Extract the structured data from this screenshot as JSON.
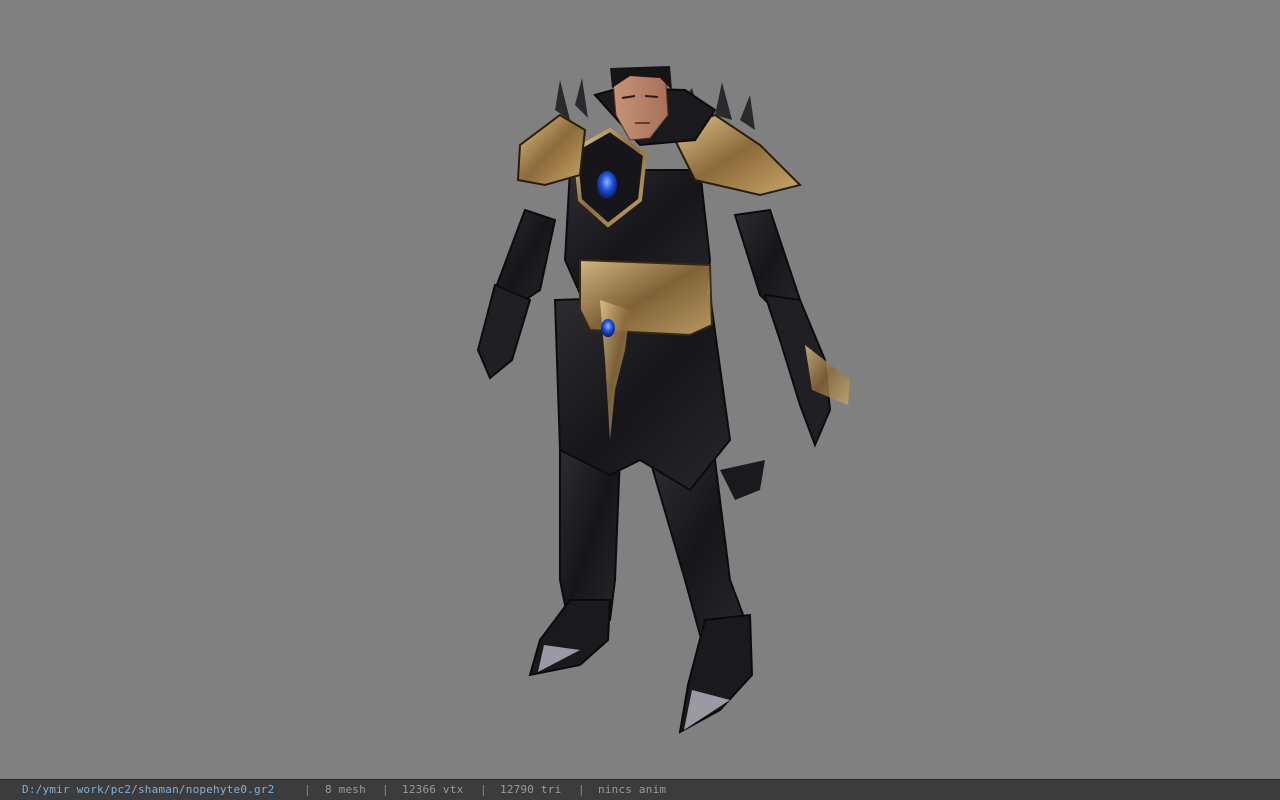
{
  "viewer": {
    "background_color": "#808080",
    "model_icon": "armored-character-model"
  },
  "status": {
    "file_path": "D:/ymir work/pc2/shaman/nopehyte0.gr2",
    "mesh_count": "8 mesh",
    "vertex_count": "12366 vtx",
    "triangle_count": "12790 tri",
    "anim_status": "nincs anim",
    "separator": "|"
  },
  "colors": {
    "armor_dark": "#1c1c20",
    "armor_gold": "#b89a5e",
    "gem_blue": "#1e50d8",
    "path_text": "#7fb0d8"
  }
}
